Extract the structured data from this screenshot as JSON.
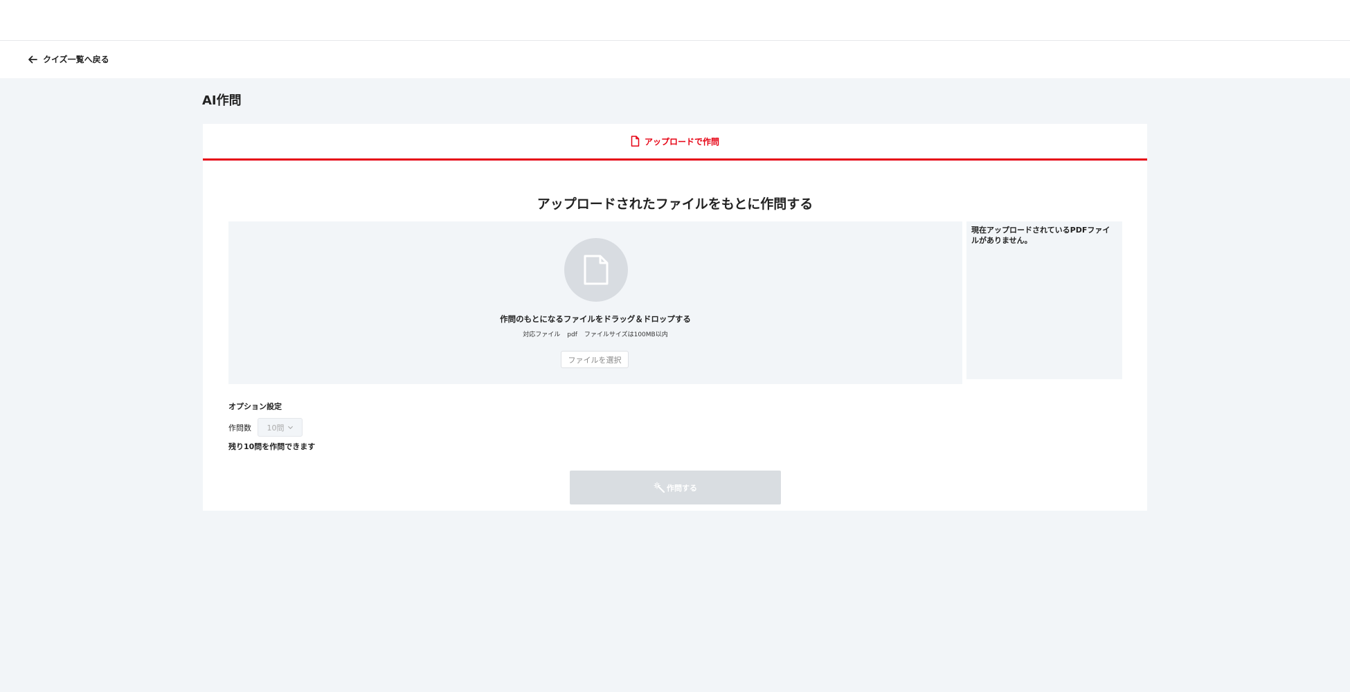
{
  "nav": {
    "back_label": "クイズ一覧へ戻る"
  },
  "page": {
    "title": "AI作問"
  },
  "tab": {
    "label": "アップロードで作問"
  },
  "upload": {
    "heading": "アップロードされたファイルをもとに作問する",
    "drop_text": "作問のもとになるファイルをドラッグ＆ドロップする",
    "supported_label": "対応ファイル",
    "supported_type": "pdf",
    "size_limit": "ファイルサイズは100MB以内",
    "select_button": "ファイルを選択",
    "icon": "file-icon"
  },
  "uploaded_files": {
    "empty_message": "現在アップロードされているPDFファイルがありません。"
  },
  "options": {
    "title": "オプション設定",
    "count_label": "作問数",
    "count_value": "10問",
    "remaining": "残り10問を作問できます"
  },
  "generate": {
    "label": "作問する",
    "icon": "magic-wand-icon"
  },
  "colors": {
    "accent": "#e60012",
    "background": "#f2f5f8",
    "disabled": "#d9dde1"
  }
}
